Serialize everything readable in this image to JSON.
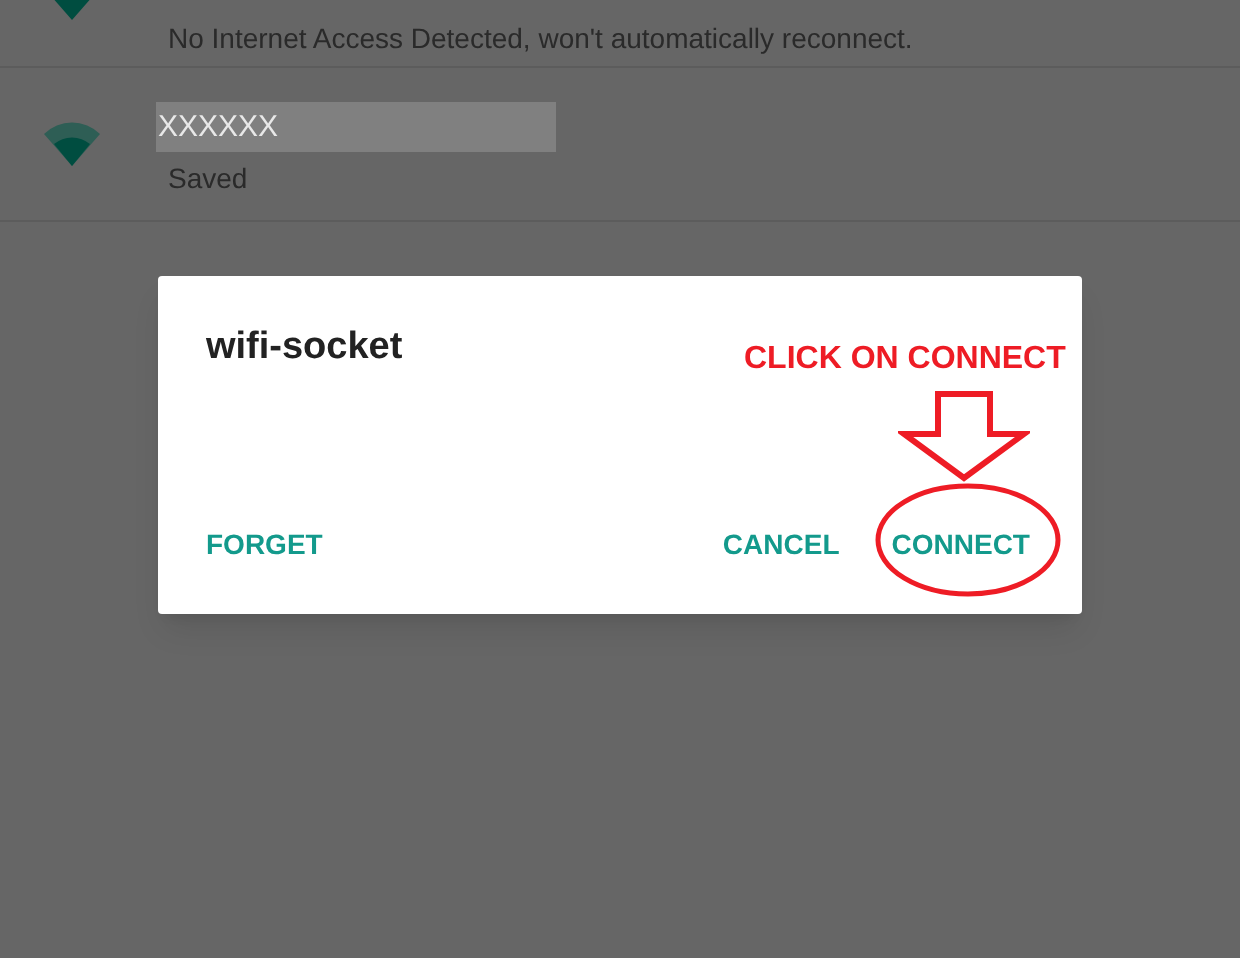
{
  "networks": [
    {
      "status": "No Internet Access Detected, won't automatically reconnect."
    },
    {
      "name": "XXXXXX",
      "status": "Saved"
    }
  ],
  "dialog": {
    "title": "wifi-socket",
    "buttons": [
      {
        "label": "FORGET",
        "kind": "left"
      },
      {
        "label": "CANCEL",
        "kind": "right"
      },
      {
        "label": "CONNECT",
        "kind": "right"
      }
    ]
  },
  "annotation": {
    "text": "CLICK ON CONNECT"
  }
}
